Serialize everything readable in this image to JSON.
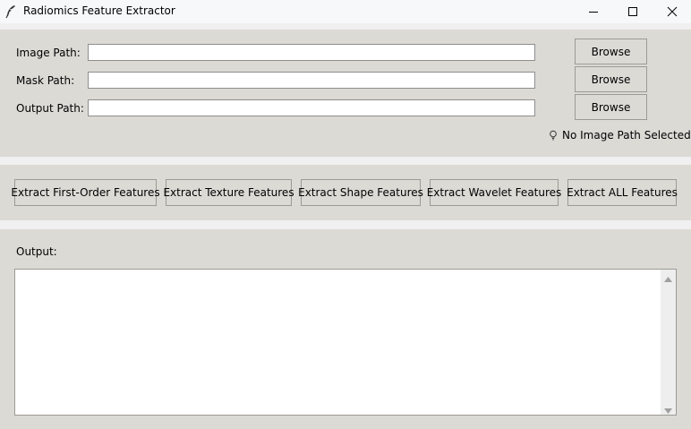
{
  "window": {
    "title": "Radiomics Feature Extractor",
    "icon": "feather-icon",
    "controls": [
      "minimize-icon",
      "maximize-icon",
      "close-icon"
    ]
  },
  "paths": {
    "image_label": "Image Path:",
    "image_value": "",
    "mask_label": "Mask Path:",
    "mask_value": "",
    "output_label": "Output Path:",
    "output_value": "",
    "browse_label": "Browse"
  },
  "status": {
    "icon": "lightbulb-icon",
    "text": "No Image Path Selected"
  },
  "actions": {
    "first_order": "Extract First-Order Features",
    "texture": "Extract Texture Features",
    "shape": "Extract Shape Features",
    "wavelet": "Extract Wavelet Features",
    "all": "Extract ALL Features"
  },
  "output": {
    "label": "Output:",
    "text": ""
  }
}
